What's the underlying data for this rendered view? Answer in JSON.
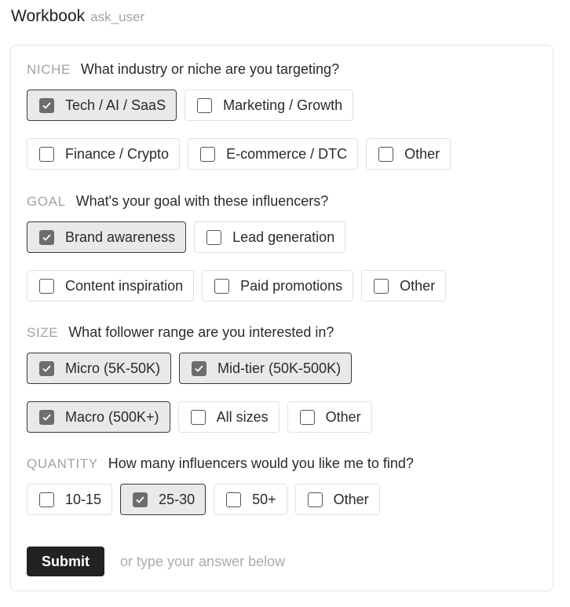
{
  "header": {
    "title": "Workbook",
    "tool": "ask_user"
  },
  "sections": [
    {
      "key": "NICHE",
      "question": "What industry or niche are you targeting?",
      "options": [
        {
          "label": "Tech / AI / SaaS",
          "checked": true
        },
        {
          "label": "Marketing / Growth",
          "checked": false
        },
        {
          "label": "Finance / Crypto",
          "checked": false
        },
        {
          "label": "E-commerce / DTC",
          "checked": false
        },
        {
          "label": "Other",
          "checked": false
        }
      ]
    },
    {
      "key": "GOAL",
      "question": "What's your goal with these influencers?",
      "options": [
        {
          "label": "Brand awareness",
          "checked": true
        },
        {
          "label": "Lead generation",
          "checked": false
        },
        {
          "label": "Content inspiration",
          "checked": false
        },
        {
          "label": "Paid promotions",
          "checked": false
        },
        {
          "label": "Other",
          "checked": false
        }
      ]
    },
    {
      "key": "SIZE",
      "question": "What follower range are you interested in?",
      "options": [
        {
          "label": "Micro (5K-50K)",
          "checked": true
        },
        {
          "label": "Mid-tier (50K-500K)",
          "checked": true
        },
        {
          "label": "Macro (500K+)",
          "checked": true
        },
        {
          "label": "All sizes",
          "checked": false
        },
        {
          "label": "Other",
          "checked": false
        }
      ]
    },
    {
      "key": "QUANTITY",
      "question": "How many influencers would you like me to find?",
      "options": [
        {
          "label": "10-15",
          "checked": false
        },
        {
          "label": "25-30",
          "checked": true
        },
        {
          "label": "50+",
          "checked": false
        },
        {
          "label": "Other",
          "checked": false
        }
      ]
    }
  ],
  "footer": {
    "submit_label": "Submit",
    "hint": "or type your answer below"
  }
}
